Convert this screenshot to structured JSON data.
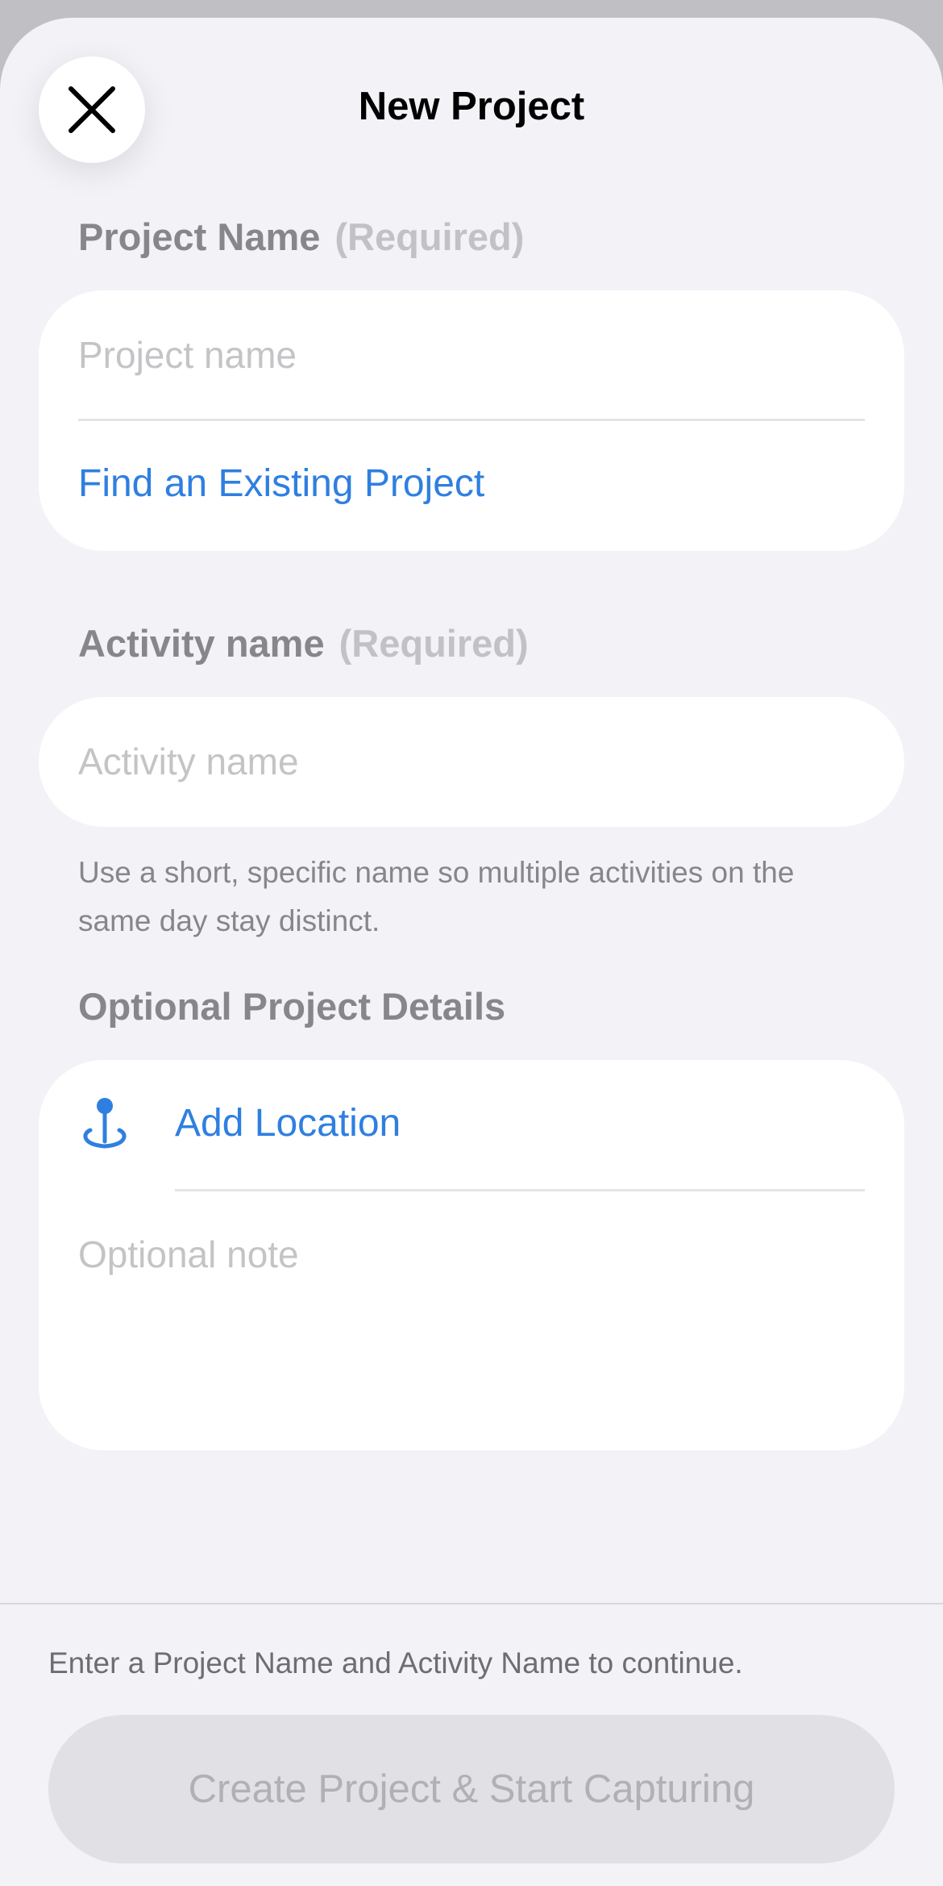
{
  "header": {
    "title": "New Project",
    "close_icon": "close-icon"
  },
  "project_section": {
    "label": "Project Name",
    "required_label": "(Required)",
    "input_value": "",
    "input_placeholder": "Project name",
    "find_existing_label": "Find an Existing Project"
  },
  "activity_section": {
    "label": "Activity name",
    "required_label": "(Required)",
    "input_value": "",
    "input_placeholder": "Activity name",
    "hint": "Use a short, specific name so multiple activities on the same day stay distinct."
  },
  "optional_section": {
    "label": "Optional Project Details",
    "location_icon": "location-pin-icon",
    "add_location_label": "Add Location",
    "note_value": "",
    "note_placeholder": "Optional note"
  },
  "footer": {
    "hint": "Enter a Project Name and Activity Name to continue.",
    "cta_label": "Create Project & Start Capturing",
    "cta_enabled": false
  },
  "colors": {
    "accent": "#2f7fe0",
    "background": "#f2f2f7",
    "card": "#ffffff",
    "secondary_text": "#86868b",
    "placeholder": "#c4c4c7",
    "disabled_button": "#e0e0e5"
  }
}
